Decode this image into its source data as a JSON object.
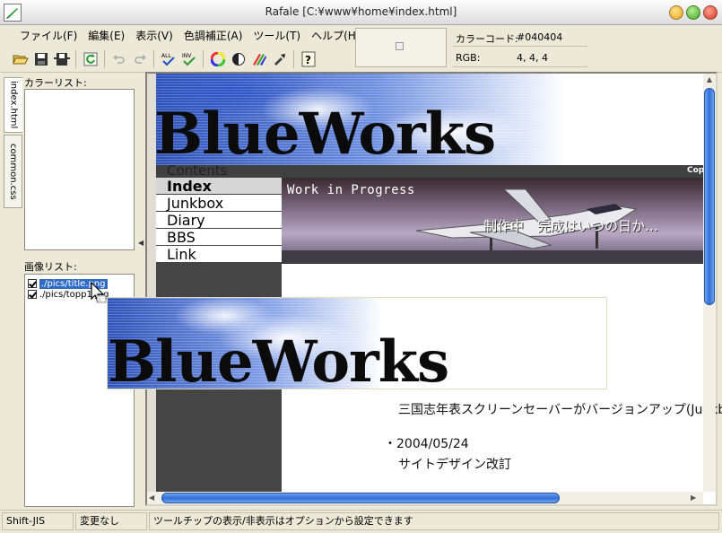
{
  "window": {
    "title": "Rafale [C:¥www¥home¥index.html]"
  },
  "menu": {
    "items": [
      "ファイル(F)",
      "編集(E)",
      "表示(V)",
      "色調補正(A)",
      "ツール(T)",
      "ヘルプ(H)"
    ]
  },
  "toolbar": {
    "icons": [
      "open-folder-icon",
      "save-icon",
      "save-all-icon",
      "refresh-icon",
      "undo-icon",
      "redo-icon",
      "check-all-icon",
      "check-invert-icon",
      "color-wheel-icon",
      "contrast-icon",
      "color-pencils-icon",
      "eyedropper-icon",
      "help-icon"
    ]
  },
  "color_info": {
    "code_label": "カラーコード:",
    "code_value": "#040404",
    "rgb_label": "RGB:",
    "rgb_value": "4, 4, 4"
  },
  "tabs": {
    "index": "index.html",
    "css": "common.css"
  },
  "panels": {
    "color_list_label": "カラーリスト:",
    "image_list_label": "画像リスト:",
    "images": [
      {
        "name": "./pics/title.png",
        "checked": true,
        "selected": true
      },
      {
        "name": "./pics/topp1.jpg",
        "checked": true,
        "selected": false
      }
    ]
  },
  "preview": {
    "brand": "BlueWorks",
    "contents_label": "Contents",
    "copyright_stub": "Cop",
    "nav": [
      "Index",
      "Junkbox",
      "Diary",
      "BBS",
      "Link"
    ],
    "active_nav": "Index",
    "banner_title": "Work in Progress",
    "banner_subtitle": "制作中　完成はいつの日か…",
    "news": [
      {
        "text": "三国志年表スクリーンセーバーがバージョンアップ(Junkbox)"
      },
      {
        "date": "・2004/05/24",
        "text": "サイトデザイン改訂"
      }
    ]
  },
  "drag_ghost": {
    "brand": "BlueWorks"
  },
  "scroll": {
    "vertical_position": 0.0,
    "horizontal_position": 0.0
  },
  "status": {
    "encoding": "Shift-JIS",
    "modified": "変更なし",
    "message": "ツールチップの表示/非表示はオプションから設定できます"
  },
  "colors": {
    "accent": "#316ac5",
    "scroll_thumb": "#2f6fd8",
    "chrome": "#ece9d8",
    "web_sidebar": "#454545"
  }
}
